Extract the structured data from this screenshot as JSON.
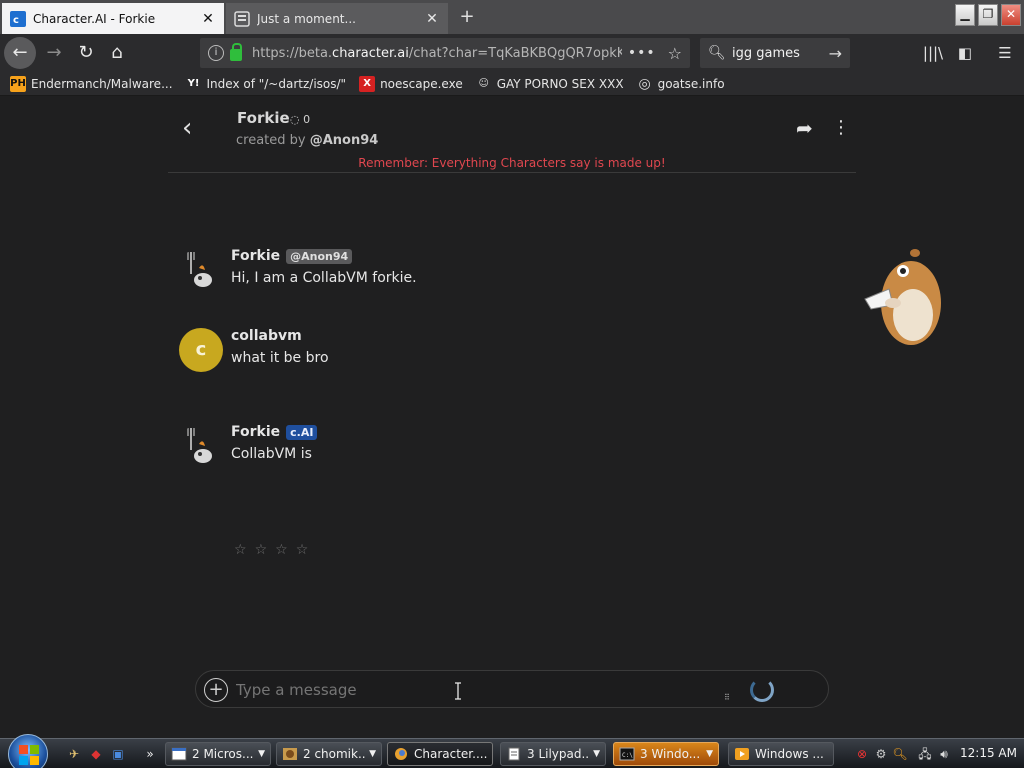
{
  "browser": {
    "tabs": [
      {
        "title": "Character.AI - Forkie",
        "active": true
      },
      {
        "title": "Just a moment...",
        "active": false
      }
    ],
    "new_tab_label": "+",
    "url_prefix": "https://beta.",
    "url_domain": "character.ai",
    "url_rest": "/chat?char=TqKaBKBQgQR7opkK",
    "search_value": "igg games",
    "bookmarks": [
      {
        "label": "Endermanch/Malware...",
        "icon": "ph-icon",
        "icon_text": "PH",
        "color": "#f7a21b"
      },
      {
        "label": "Index of \"/~dartz/isos/\"",
        "icon": "yp-icon",
        "icon_text": "Y!",
        "color": "#2b2b2d"
      },
      {
        "label": "noescape.exe",
        "icon": "x-icon",
        "icon_text": "X",
        "color": "#d62222"
      },
      {
        "label": "GAY PORNO SEX XXX",
        "icon": "crab-icon",
        "icon_text": "☺",
        "color": "#2b2b2d"
      },
      {
        "label": "goatse.info",
        "icon": "globe-icon",
        "icon_text": "◎",
        "color": "#2b2b2d"
      }
    ]
  },
  "chat": {
    "character_name": "Forkie",
    "interaction_count": "0",
    "created_by_prefix": "created by ",
    "creator": "@Anon94",
    "warning": "Remember: Everything Characters say is made up!",
    "messages": [
      {
        "author": "Forkie",
        "badge": "@Anon94",
        "badge_type": "user",
        "text": "Hi, I am a CollabVM forkie.",
        "avatar": "forkie"
      },
      {
        "author": "collabvm",
        "badge": "",
        "badge_type": "",
        "text": "what it be bro",
        "avatar": "letter",
        "avatar_letter": "c"
      },
      {
        "author": "Forkie",
        "badge": "c.AI",
        "badge_type": "cai",
        "text": "CollabVM is",
        "avatar": "forkie"
      }
    ],
    "rating_stars": 4,
    "composer_placeholder": "Type a message"
  },
  "taskbar": {
    "tasks": [
      {
        "label": "2 Micros...",
        "icon": "window-icon",
        "has_menu": true
      },
      {
        "label": "2 chomik...",
        "icon": "image-icon",
        "has_menu": true
      },
      {
        "label": "Character....",
        "icon": "firefox-icon",
        "has_menu": false,
        "active": true
      },
      {
        "label": "3 Lilypad...",
        "icon": "notepad-icon",
        "has_menu": true
      },
      {
        "label": "3 Windo...",
        "icon": "cmd-icon",
        "has_menu": true,
        "highlight": "orange"
      },
      {
        "label": "Windows ...",
        "icon": "media-icon",
        "has_menu": false
      }
    ],
    "clock": "12:15 AM"
  }
}
